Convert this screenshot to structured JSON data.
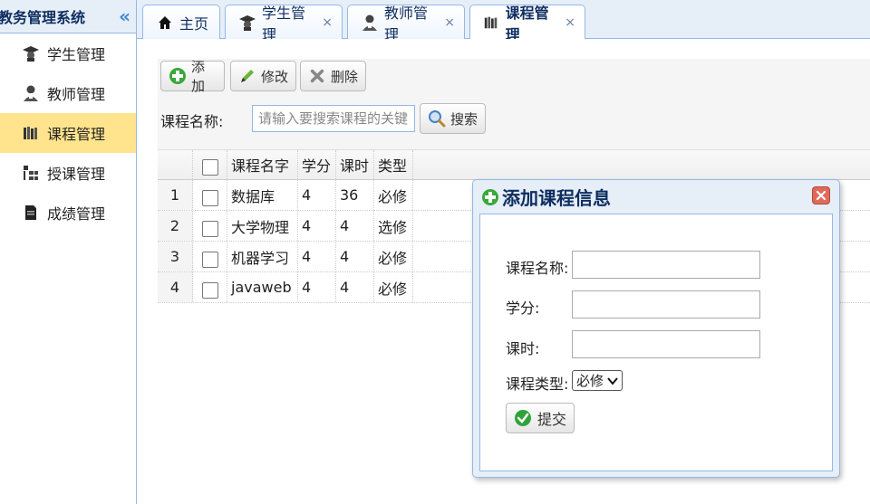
{
  "sidebar": {
    "title": "教务管理系统",
    "collapse_glyph": "«",
    "items": [
      {
        "label": "学生管理",
        "icon": "graduate-icon"
      },
      {
        "label": "教师管理",
        "icon": "teacher-icon"
      },
      {
        "label": "课程管理",
        "icon": "books-icon",
        "active": true
      },
      {
        "label": "授课管理",
        "icon": "org-chart-icon"
      },
      {
        "label": "成绩管理",
        "icon": "document-icon"
      }
    ]
  },
  "tabs": [
    {
      "label": "主页",
      "icon": "home-icon",
      "closable": false
    },
    {
      "label": "学生管理",
      "icon": "graduate-icon",
      "closable": true
    },
    {
      "label": "教师管理",
      "icon": "teacher-icon",
      "closable": true
    },
    {
      "label": "课程管理",
      "icon": "books-icon",
      "closable": true,
      "selected": true
    }
  ],
  "tab_close_glyph": "×",
  "toolbar": {
    "add_label": "添加",
    "edit_label": "修改",
    "delete_label": "删除",
    "search_label": "课程名称:",
    "search_placeholder": "请输入要搜索课程的关键字",
    "search_button": "搜索"
  },
  "grid": {
    "columns": [
      "课程名字",
      "学分",
      "课时",
      "类型"
    ],
    "rows": [
      {
        "num": "1",
        "name": "数据库",
        "credit": "4",
        "hours": "36",
        "type": "必修"
      },
      {
        "num": "2",
        "name": "大学物理",
        "credit": "4",
        "hours": "4",
        "type": "选修"
      },
      {
        "num": "3",
        "name": "机器学习",
        "credit": "4",
        "hours": "4",
        "type": "必修"
      },
      {
        "num": "4",
        "name": "javaweb",
        "credit": "4",
        "hours": "4",
        "type": "必修"
      }
    ]
  },
  "dialog": {
    "title": "添加课程信息",
    "fields": {
      "name_label": "课程名称:",
      "credit_label": "学分:",
      "hours_label": "课时:",
      "type_label": "课程类型:"
    },
    "type_selected": "必修",
    "submit_label": "提交"
  },
  "colors": {
    "border": "#95b8e7",
    "header_bg": "#e6eef8",
    "active_item": "#ffe48d",
    "add_green": "#3aa83a",
    "close_red": "#e06a5a"
  }
}
